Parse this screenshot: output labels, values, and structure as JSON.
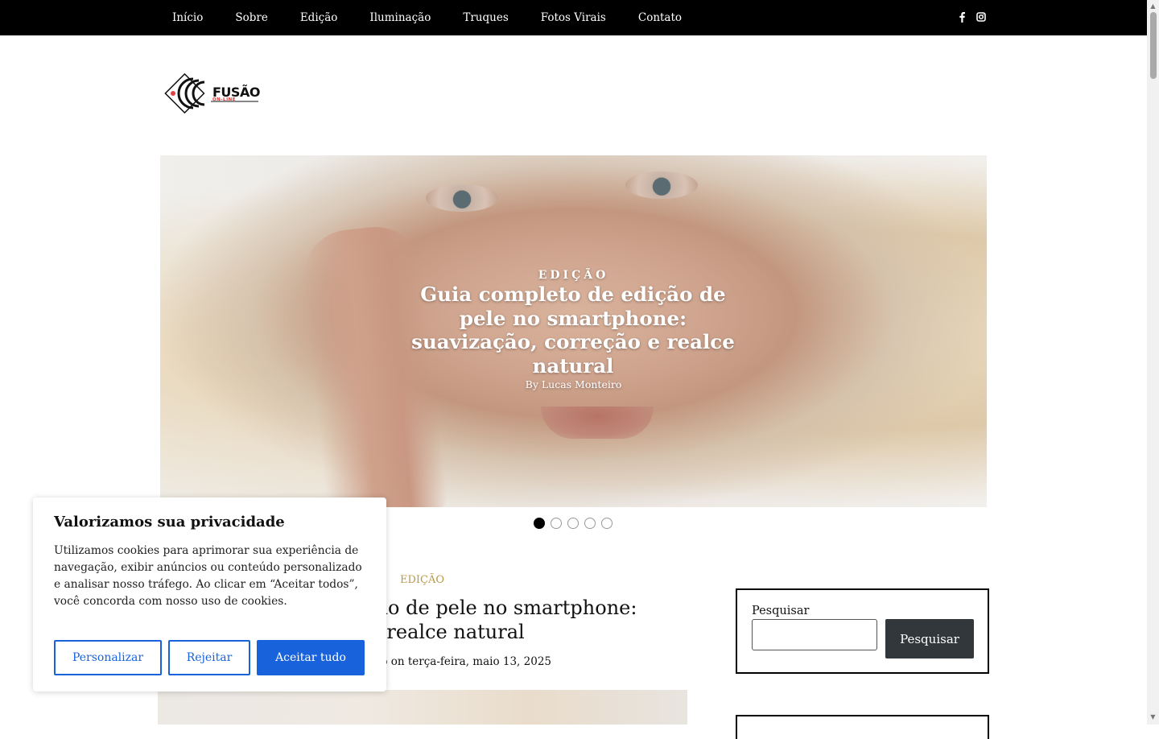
{
  "nav": {
    "items": [
      {
        "label": "Início"
      },
      {
        "label": "Sobre"
      },
      {
        "label": "Edição"
      },
      {
        "label": "Iluminação"
      },
      {
        "label": "Truques"
      },
      {
        "label": "Fotos Virais"
      },
      {
        "label": "Contato"
      }
    ],
    "social": [
      "facebook-icon",
      "instagram-icon"
    ]
  },
  "logo": {
    "name": "FUSÃO",
    "tagline": "ON-LINE"
  },
  "hero": {
    "category": "EDIÇÃO",
    "title": "Guia completo de edição de pele no smartphone: suavização, correção e realce natural",
    "byline": "By Lucas Monteiro"
  },
  "slider": {
    "count": 5,
    "active_index": 0
  },
  "post": {
    "category": "EDIÇÃO",
    "title": "Guia completo de edição de pele no smartphone: suavização, correção e realce natural",
    "meta": "By Lucas Monteiro on terça-feira, maio 13, 2025"
  },
  "sidebar": {
    "search_label": "Pesquisar",
    "search_button": "Pesquisar"
  },
  "cookie": {
    "title": "Valorizamos sua privacidade",
    "text": "Utilizamos cookies para aprimorar sua experiência de navegação, exibir anúncios ou conteúdo personalizado e analisar nosso tráfego. Ao clicar em “Aceitar todos”, você concorda com nosso uso de cookies.",
    "customize": "Personalizar",
    "reject": "Rejeitar",
    "accept": "Aceitar tudo"
  },
  "colors": {
    "accent": "#1863dc",
    "category": "#b89a4a",
    "topbar": "#000000"
  }
}
